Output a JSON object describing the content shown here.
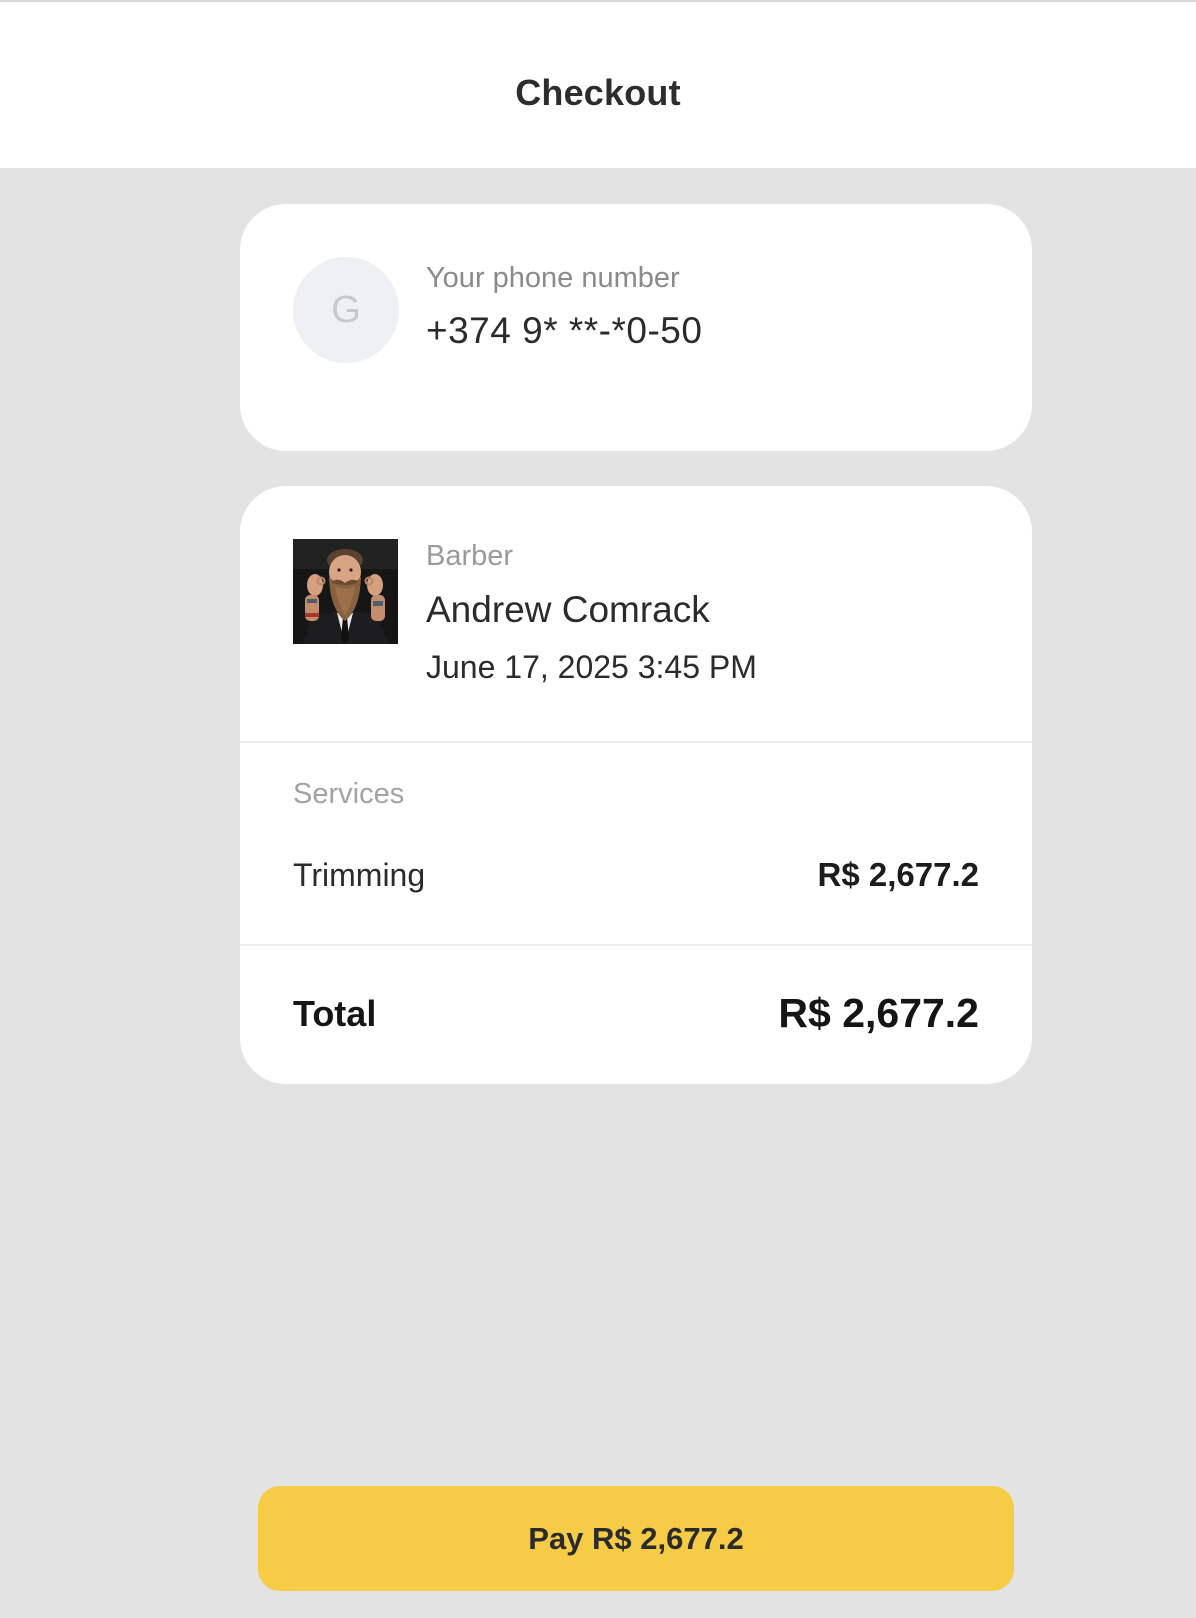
{
  "header": {
    "title": "Checkout"
  },
  "contact": {
    "avatar_initial": "G",
    "phone_label": "Your phone number",
    "phone_value": "+374 9* **-*0-50"
  },
  "appointment": {
    "role": "Barber",
    "barber_name": "Andrew Comrack",
    "datetime": "June 17, 2025 3:45 PM",
    "photo_icon": "barber-photo"
  },
  "services": {
    "label": "Services",
    "items": [
      {
        "name": "Trimming",
        "price": "R$ 2,677.2"
      }
    ]
  },
  "total": {
    "label": "Total",
    "value": "R$ 2,677.2"
  },
  "pay_button": {
    "label": "Pay R$ 2,677.2"
  },
  "colors": {
    "background": "#e3e3e3",
    "card": "#ffffff",
    "accent": "#f6cc46"
  }
}
